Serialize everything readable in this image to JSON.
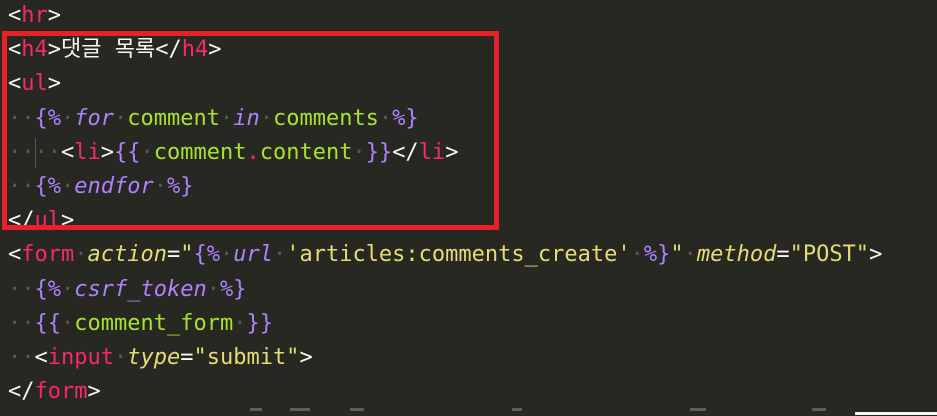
{
  "editor": {
    "lines": [
      {
        "indent": 0,
        "tokens": [
          {
            "c": "bracket",
            "t": "<"
          },
          {
            "c": "tag",
            "t": "hr"
          },
          {
            "c": "bracket",
            "t": ">"
          }
        ]
      },
      {
        "indent": 0,
        "tokens": [
          {
            "c": "bracket",
            "t": "<"
          },
          {
            "c": "tag",
            "t": "h4"
          },
          {
            "c": "bracket",
            "t": ">"
          },
          {
            "c": "text",
            "t": "댓글 목록"
          },
          {
            "c": "bracket",
            "t": "</"
          },
          {
            "c": "tag",
            "t": "h4"
          },
          {
            "c": "bracket",
            "t": ">"
          }
        ]
      },
      {
        "indent": 0,
        "tokens": [
          {
            "c": "bracket",
            "t": "<"
          },
          {
            "c": "tag",
            "t": "ul"
          },
          {
            "c": "bracket",
            "t": ">"
          }
        ]
      },
      {
        "indent": 1,
        "tokens": [
          {
            "c": "tpl",
            "t": "{%"
          },
          {
            "c": "text",
            "t": " "
          },
          {
            "c": "kw",
            "t": "for"
          },
          {
            "c": "text",
            "t": " "
          },
          {
            "c": "ident",
            "t": "comment"
          },
          {
            "c": "text",
            "t": " "
          },
          {
            "c": "kw",
            "t": "in"
          },
          {
            "c": "text",
            "t": " "
          },
          {
            "c": "ident",
            "t": "comments"
          },
          {
            "c": "text",
            "t": " "
          },
          {
            "c": "tpl",
            "t": "%}"
          }
        ]
      },
      {
        "indent": 2,
        "tokens": [
          {
            "c": "bracket",
            "t": "<"
          },
          {
            "c": "tag",
            "t": "li"
          },
          {
            "c": "bracket",
            "t": ">"
          },
          {
            "c": "tpl",
            "t": "{{"
          },
          {
            "c": "text",
            "t": " "
          },
          {
            "c": "ident",
            "t": "comment"
          },
          {
            "c": "punc",
            "t": "."
          },
          {
            "c": "ident",
            "t": "content"
          },
          {
            "c": "text",
            "t": " "
          },
          {
            "c": "tpl",
            "t": "}}"
          },
          {
            "c": "bracket",
            "t": "</"
          },
          {
            "c": "tag",
            "t": "li"
          },
          {
            "c": "bracket",
            "t": ">"
          }
        ]
      },
      {
        "indent": 1,
        "tokens": [
          {
            "c": "tpl",
            "t": "{%"
          },
          {
            "c": "text",
            "t": " "
          },
          {
            "c": "kw",
            "t": "endfor"
          },
          {
            "c": "text",
            "t": " "
          },
          {
            "c": "tpl",
            "t": "%}"
          }
        ]
      },
      {
        "indent": 0,
        "tokens": [
          {
            "c": "bracket",
            "t": "</"
          },
          {
            "c": "tag",
            "t": "ul"
          },
          {
            "c": "bracket",
            "t": ">"
          }
        ]
      },
      {
        "indent": 0,
        "tokens": [
          {
            "c": "bracket",
            "t": "<"
          },
          {
            "c": "tag",
            "t": "form"
          },
          {
            "c": "text",
            "t": " "
          },
          {
            "c": "attr2",
            "t": "action"
          },
          {
            "c": "text",
            "t": "="
          },
          {
            "c": "str",
            "t": "\""
          },
          {
            "c": "tpl",
            "t": "{%"
          },
          {
            "c": "text",
            "t": " "
          },
          {
            "c": "kw",
            "t": "url"
          },
          {
            "c": "text",
            "t": " "
          },
          {
            "c": "str",
            "t": "'articles:comments_create'"
          },
          {
            "c": "text",
            "t": " "
          },
          {
            "c": "tpl",
            "t": "%}"
          },
          {
            "c": "str",
            "t": "\""
          },
          {
            "c": "text",
            "t": " "
          },
          {
            "c": "attr2",
            "t": "method"
          },
          {
            "c": "text",
            "t": "="
          },
          {
            "c": "str",
            "t": "\"POST\""
          },
          {
            "c": "bracket",
            "t": ">"
          }
        ]
      },
      {
        "indent": 1,
        "tokens": [
          {
            "c": "tpl",
            "t": "{%"
          },
          {
            "c": "text",
            "t": " "
          },
          {
            "c": "kw",
            "t": "csrf_token"
          },
          {
            "c": "text",
            "t": " "
          },
          {
            "c": "tpl",
            "t": "%}"
          }
        ]
      },
      {
        "indent": 1,
        "tokens": [
          {
            "c": "tpl",
            "t": "{{"
          },
          {
            "c": "text",
            "t": " "
          },
          {
            "c": "ident",
            "t": "comment_form"
          },
          {
            "c": "text",
            "t": " "
          },
          {
            "c": "tpl",
            "t": "}}"
          }
        ]
      },
      {
        "indent": 1,
        "tokens": [
          {
            "c": "bracket",
            "t": "<"
          },
          {
            "c": "tag",
            "t": "input"
          },
          {
            "c": "text",
            "t": " "
          },
          {
            "c": "attr2",
            "t": "type"
          },
          {
            "c": "text",
            "t": "="
          },
          {
            "c": "str",
            "t": "\"submit\""
          },
          {
            "c": "bracket",
            "t": ">"
          }
        ]
      },
      {
        "indent": 0,
        "tokens": [
          {
            "c": "bracket",
            "t": "</"
          },
          {
            "c": "tag",
            "t": "form"
          },
          {
            "c": "bracket",
            "t": ">"
          }
        ]
      }
    ]
  },
  "colors": {
    "background": "#272822",
    "tag": "#f92672",
    "template_delimiter": "#ae81ff",
    "identifier": "#a6e22e",
    "string": "#e6db74",
    "highlight_box": "#e8202a"
  }
}
